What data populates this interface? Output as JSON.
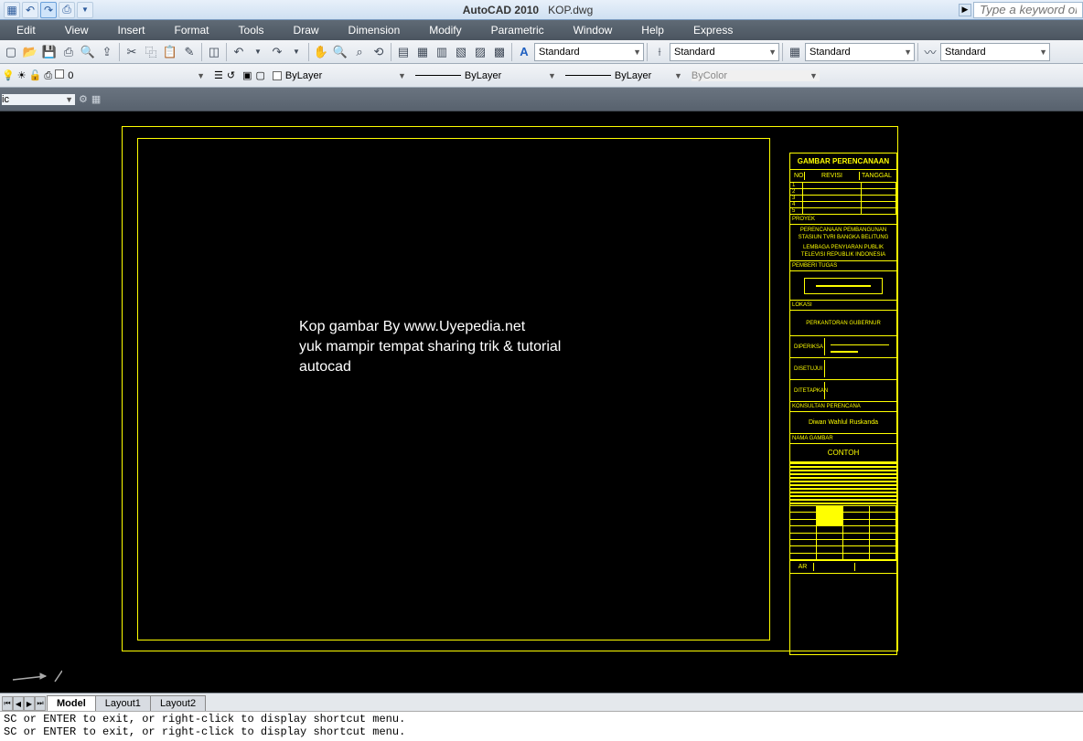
{
  "title": {
    "app": "AutoCAD 2010",
    "file": "KOP.dwg"
  },
  "search": {
    "placeholder": "Type a keyword or phras"
  },
  "menus": [
    "Edit",
    "View",
    "Insert",
    "Format",
    "Tools",
    "Draw",
    "Dimension",
    "Modify",
    "Parametric",
    "Window",
    "Help",
    "Express"
  ],
  "styles": {
    "text": "Standard",
    "dim": "Standard",
    "table": "Standard",
    "ml": "Standard"
  },
  "layer": {
    "current": "0"
  },
  "props": {
    "color": "ByLayer",
    "linetype": "ByLayer",
    "lineweight": "ByLayer",
    "plotstyle": "ByColor"
  },
  "tabs": {
    "model": "Model",
    "layout1": "Layout1",
    "layout2": "Layout2"
  },
  "cmdline": {
    "l1": "SC or ENTER to exit, or right-click to display shortcut menu.",
    "l2": "SC or ENTER to exit, or right-click to display shortcut menu."
  },
  "overlay": {
    "l1": "Kop gambar By www.Uyepedia.net",
    "l2": "yuk mampir tempat  sharing  trik & tutorial",
    "l3": "autocad"
  },
  "titleblock": {
    "header": "GAMBAR PERENCANAAN",
    "cols": {
      "no": "NO",
      "revisi": "REVISI",
      "tanggal": "TANGGAL"
    },
    "rows": [
      "1",
      "2",
      "3",
      "4",
      "5"
    ],
    "proyek_label": "PROYEK",
    "proyek_l1": "PERENCANAAN PEMBANGUNAN",
    "proyek_l2": "STASIUN TVRI BANGKA BELITUNG",
    "proyek_l3": "LEMBAGA PENYIARAN PUBLIK",
    "proyek_l4": "TELEVISI REPUBLIK INDONESIA",
    "pemberi": "PEMBERI TUGAS",
    "lokasi_label": "LOKASI",
    "lokasi": "PERKANTORAN GUBERNUR",
    "diperiksa": "DIPERIKSA",
    "disetujui": "DISETUJUI",
    "ditetapkan": "DITETAPKAN",
    "konsultan": "KONSULTAN PERENCANA",
    "konsultan_name": "Diwan Wahlul Ruskanda",
    "namagambar": "NAMA GAMBAR",
    "contoh": "CONTOH",
    "ar": "AR"
  }
}
